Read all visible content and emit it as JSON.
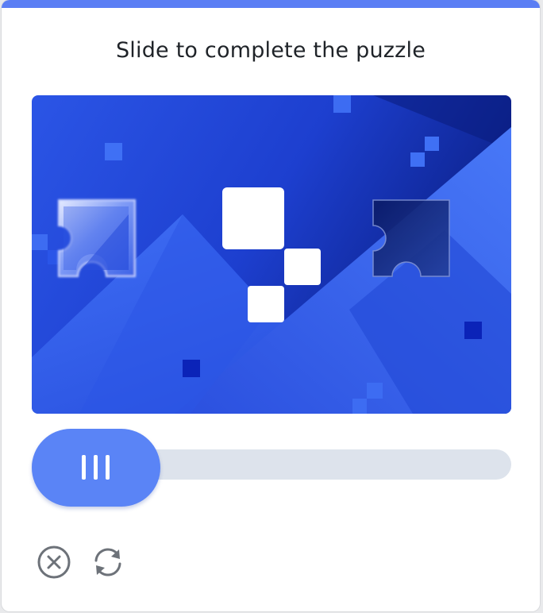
{
  "dialog": {
    "title": "Slide to complete the puzzle"
  },
  "slider": {
    "handle_icon": "grip-lines-icon",
    "progress": 0
  },
  "footer": {
    "close_icon": "close-circle-icon",
    "refresh_icon": "refresh-icon"
  },
  "colors": {
    "accent": "#5b7ef4",
    "track": "#dde3ec",
    "image_dark": "#0f2c9e",
    "image_light": "#3d6cf2"
  }
}
